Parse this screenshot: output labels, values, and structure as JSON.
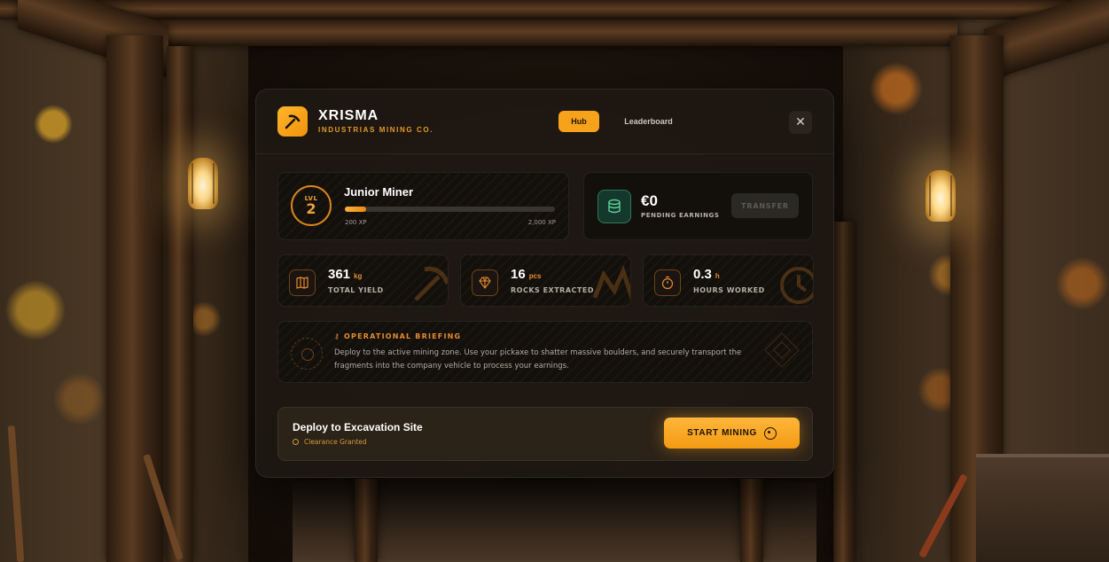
{
  "brand": {
    "name": "XRISMA",
    "subtitle": "INDUSTRIAS MINING CO."
  },
  "tabs": [
    {
      "label": "Hub",
      "active": true
    },
    {
      "label": "Leaderboard",
      "active": false
    }
  ],
  "close_icon": "close-icon",
  "player": {
    "level_label": "LVL",
    "level": "2",
    "rank": "Junior Miner",
    "xp_current": "200 XP",
    "xp_target": "2,000 XP",
    "xp_progress": 0.1
  },
  "earnings": {
    "amount": "€0",
    "label": "PENDING EARNINGS",
    "transfer_label": "TRANSFER",
    "icon": "database-icon"
  },
  "stats": [
    {
      "value": "361",
      "unit": "kg",
      "label": "TOTAL YIELD",
      "icon": "map-icon"
    },
    {
      "value": "16",
      "unit": "pcs",
      "label": "ROCKS EXTRACTED",
      "icon": "gem-icon"
    },
    {
      "value": "0.3",
      "unit": "h",
      "label": "HOURS WORKED",
      "icon": "stopwatch-icon"
    }
  ],
  "briefing": {
    "title": "OPERATIONAL BRIEFING",
    "text": "Deploy to the active mining zone. Use your pickaxe to shatter massive boulders, and securely transport the fragments into the company vehicle to process your earnings."
  },
  "deploy": {
    "title": "Deploy to Excavation Site",
    "status": "Clearance Granted",
    "button_label": "START MINING"
  },
  "colors": {
    "accent": "#f7a21b",
    "panel": "#1e1812",
    "success": "#2f7a57"
  }
}
